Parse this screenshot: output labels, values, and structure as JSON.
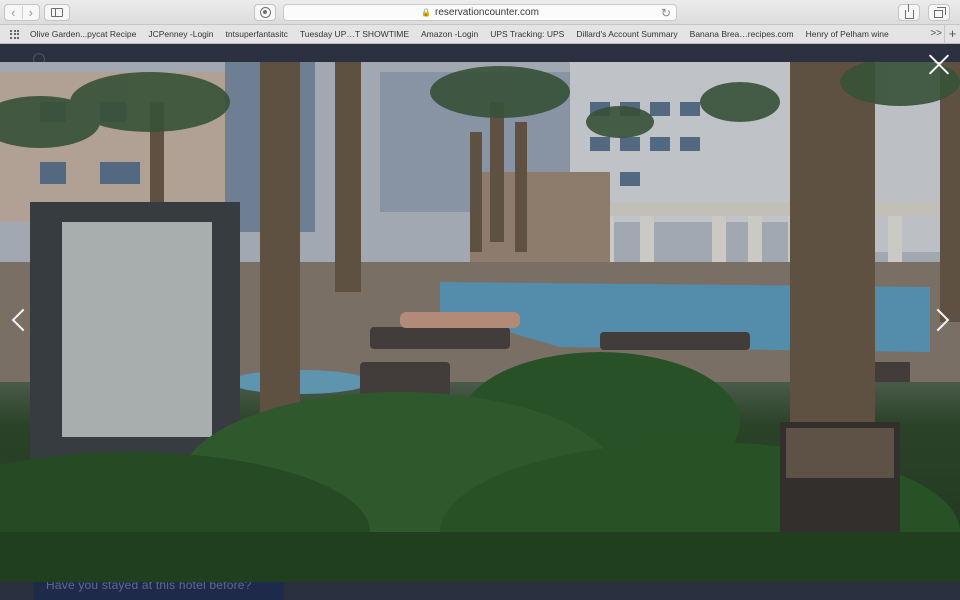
{
  "browser": {
    "nav_back_glyph": "‹",
    "nav_forward_glyph": "›",
    "address": "reservationcounter.com",
    "reload_glyph": "↻",
    "lock_glyph": "🔒",
    "add_tab_glyph": "+",
    "more_bookmarks_glyph": ">>"
  },
  "bookmarks": [
    "Olive Garden...pycat Recipe",
    "JCPenney -Login",
    "tntsuperfantasitc",
    "Tuesday UP…T SHOWTIME",
    "Amazon -Login",
    "UPS Tracking: UPS",
    "Dillard's Account Summary",
    "Banana Brea…recipes.com",
    "Henry of Pelham wine"
  ],
  "page": {
    "bottom_prompt": "Have you stayed at this hotel before?"
  },
  "lightbox": {
    "image_icon": "hotel-pool-photo",
    "close_icon": "close-icon",
    "prev_icon": "chevron-left-icon",
    "next_icon": "chevron-right-icon"
  }
}
